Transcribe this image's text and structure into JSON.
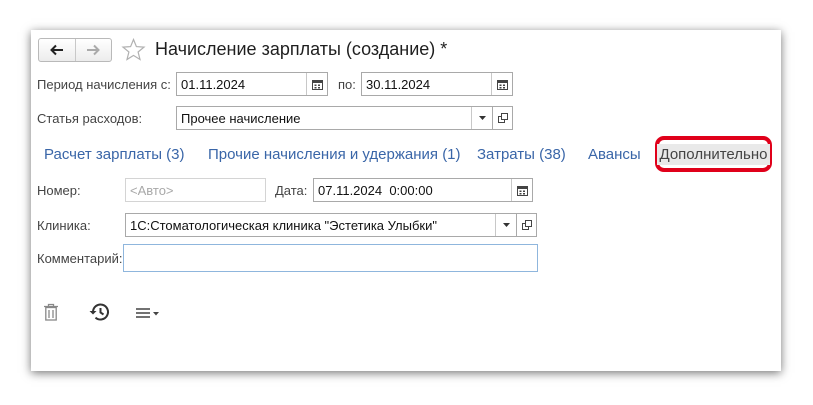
{
  "window": {
    "title": "Начисление зарплаты (создание) *"
  },
  "nav": {
    "back_icon": "arrow-left-icon",
    "forward_icon": "arrow-right-icon",
    "favorite_icon": "star-icon"
  },
  "period": {
    "from_label": "Период начисления с:",
    "from_value": "01.11.2024",
    "to_label": "по:",
    "to_value": "30.11.2024"
  },
  "expense": {
    "label": "Статья расходов:",
    "value": "Прочее начисление"
  },
  "tabs": [
    {
      "label": "Расчет зарплаты (3)"
    },
    {
      "label": "Прочие начисления и удержания (1)"
    },
    {
      "label": "Затраты (38)"
    },
    {
      "label": "Авансы"
    },
    {
      "label": "Дополнительно",
      "active": true
    }
  ],
  "details": {
    "number_label": "Номер:",
    "number_placeholder": "<Авто>",
    "date_label": "Дата:",
    "date_value": "07.11.2024  0:00:00",
    "clinic_label": "Клиника:",
    "clinic_value": "1С:Стоматологическая клиника \"Эстетика Улыбки\"",
    "comment_label": "Комментарий:",
    "comment_value": ""
  },
  "colors": {
    "tab_link": "#3a66a8",
    "highlight_border": "#e0001a",
    "focus_border": "#8fb6dd"
  }
}
